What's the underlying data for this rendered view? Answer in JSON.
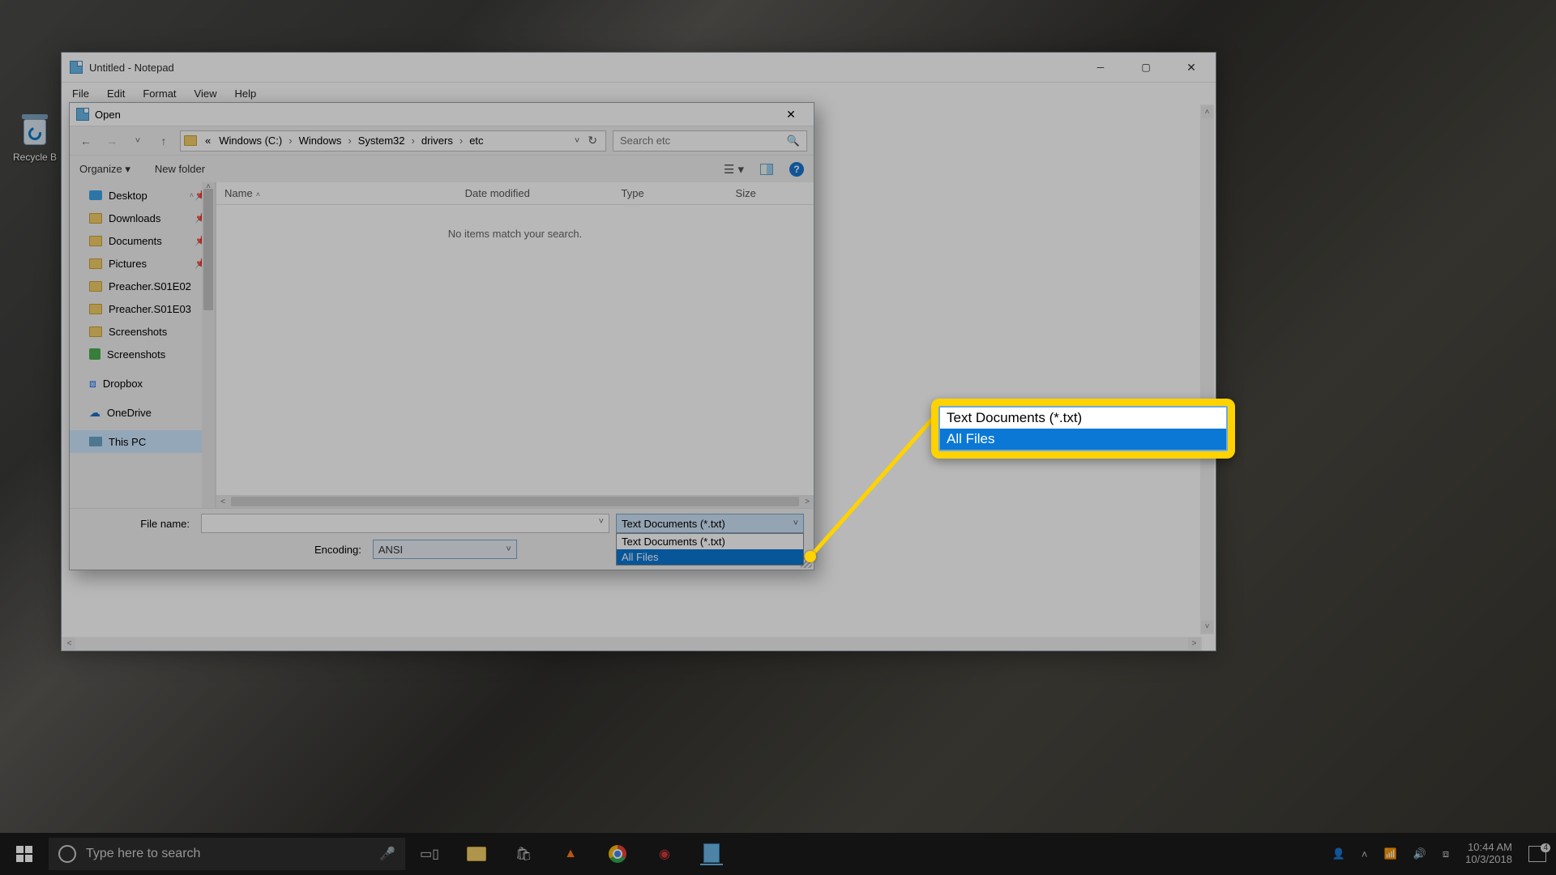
{
  "desktop": {
    "recycle_bin": "Recycle B"
  },
  "notepad": {
    "title": "Untitled - Notepad",
    "menu": {
      "file": "File",
      "edit": "Edit",
      "format": "Format",
      "view": "View",
      "help": "Help"
    }
  },
  "open_dialog": {
    "title": "Open",
    "breadcrumb": {
      "prefix": "«",
      "parts": [
        "Windows (C:)",
        "Windows",
        "System32",
        "drivers",
        "etc"
      ]
    },
    "search_placeholder": "Search etc",
    "toolbar": {
      "organize": "Organize ▾",
      "new_folder": "New folder"
    },
    "columns": {
      "name": "Name",
      "date": "Date modified",
      "type": "Type",
      "size": "Size"
    },
    "empty": "No items match your search.",
    "sidebar": {
      "quick": [
        {
          "label": "Desktop",
          "pinned": true
        },
        {
          "label": "Downloads",
          "pinned": true
        },
        {
          "label": "Documents",
          "pinned": true
        },
        {
          "label": "Pictures",
          "pinned": true
        },
        {
          "label": "Preacher.S01E02",
          "pinned": false
        },
        {
          "label": "Preacher.S01E03",
          "pinned": false
        },
        {
          "label": "Screenshots",
          "pinned": false
        },
        {
          "label": "Screenshots",
          "pinned": false
        }
      ],
      "dropbox": "Dropbox",
      "onedrive": "OneDrive",
      "this_pc": "This PC"
    },
    "footer": {
      "file_name_label": "File name:",
      "file_name_value": "",
      "encoding_label": "Encoding:",
      "encoding_value": "ANSI",
      "filetype_selected": "Text Documents (*.txt)",
      "filetype_options": [
        "Text Documents (*.txt)",
        "All Files"
      ]
    }
  },
  "callout": {
    "options": [
      "Text Documents (*.txt)",
      "All Files"
    ]
  },
  "taskbar": {
    "search_placeholder": "Type here to search",
    "time": "10:44 AM",
    "date": "10/3/2018",
    "notification_count": "4"
  }
}
